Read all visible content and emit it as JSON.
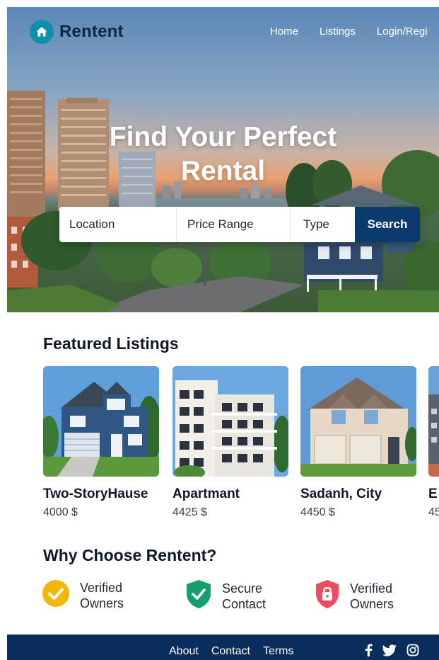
{
  "brand": {
    "name": "Rentent",
    "logo_icon": "home-icon",
    "logo_color": "#0e8fa8"
  },
  "nav": {
    "items": [
      {
        "label": "Home"
      },
      {
        "label": "Listings"
      },
      {
        "label": "Login/Regi"
      }
    ]
  },
  "hero": {
    "title_line1": "Find Your Perfect",
    "title_line2": "Rental"
  },
  "search": {
    "location_label": "Location",
    "price_label": "Price Range",
    "type_label": "Type",
    "button_label": "Search",
    "button_color": "#0b3a6e"
  },
  "featured": {
    "title": "Featured Listings",
    "listings": [
      {
        "name": "Two-StoryHause",
        "price": "4000 $"
      },
      {
        "name": "Apartmant",
        "price": "4425 $"
      },
      {
        "name": "Sadanh, City",
        "price": "4450 $"
      },
      {
        "name": "E",
        "price": "45"
      }
    ]
  },
  "why": {
    "title": "Why Choose Rentent?",
    "items": [
      {
        "line1": "Verified",
        "line2": "Owners",
        "icon": "check-circle-icon",
        "color": "#f2b705"
      },
      {
        "line1": "Secure",
        "line2": "Contact",
        "icon": "shield-check-icon",
        "color": "#14a06a"
      },
      {
        "line1": "Verified",
        "line2": "Owners",
        "icon": "lock-shield-icon",
        "color": "#ef4b5f"
      }
    ]
  },
  "footer": {
    "links": [
      {
        "label": "About"
      },
      {
        "label": "Contact"
      },
      {
        "label": "Terms"
      }
    ],
    "socials": [
      "facebook-icon",
      "twitter-icon",
      "instagram-icon"
    ],
    "background": "#0b2d5b"
  }
}
